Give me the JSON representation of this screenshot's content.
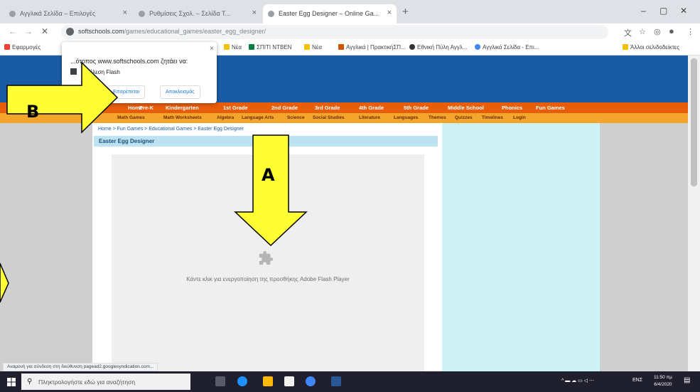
{
  "browser": {
    "tabs": [
      {
        "label": "Αγγλικά Σελίδα – Επιλογές"
      },
      {
        "label": "Ρυθμίσεις Σχολ. – Σελίδα Τ..."
      },
      {
        "label": "Easter Egg Designer – Online Ga..."
      }
    ],
    "newtab": "+",
    "win_controls": [
      "–",
      "▢",
      "✕"
    ],
    "url_host": "softschools.com",
    "url_path": "/games/educational_games/easter_egg_designer/",
    "bookmarks": [
      {
        "label": "Εφαρμογές"
      },
      {
        "label": "Νέα"
      },
      {
        "label": "ΣΠΙΤΙ ΝΤΒΕΝ"
      },
      {
        "label": "Νέα"
      },
      {
        "label": "Αγγλικά | ΠρακτικήΣΠ..."
      },
      {
        "label": "Εθνική Πύλη Αγγλ..."
      },
      {
        "label": "Αγγλικά Σελίδα - Επι..."
      },
      {
        "label": "Άλλοι σελιδοδείκτες"
      }
    ]
  },
  "popup": {
    "title": "...ότοπος www.softschools.com ζητάει να:",
    "row": "Εκτέλεση Flash",
    "allow": "Επιτρέπεται",
    "block": "Αποκλεισμός",
    "close": "×"
  },
  "site": {
    "nav1": [
      "Home",
      "Pre-K",
      "Kindergarten",
      "1st Grade",
      "2nd Grade",
      "3rd Grade",
      "4th Grade",
      "5th Grade",
      "Middle School",
      "Phonics",
      "Fun Games"
    ],
    "nav2": [
      "Math Games",
      "Math Worksheets",
      "Algebra",
      "Language Arts",
      "Science",
      "Social Studies",
      "Literature",
      "Languages",
      "Themes",
      "Quizzes",
      "Timelines",
      "Login"
    ],
    "breadcrumb": "Home > Fun Games > Educational Games > Easter Egg Designer",
    "page_title": "Easter Egg Designer",
    "plugin_message": "Κάντε κλικ για ενεργοποίηση της προσθήκης Adobe Flash Player"
  },
  "status_text": "Αναμονή για σύνδεση στη διεύθυνση pagead2.googlesyndication.com...",
  "taskbar": {
    "search_placeholder": "Πληκτρολογήστε εδώ για αναζήτηση",
    "tray_text": "ΕΝΣ",
    "clock_time": "11:50 πμ",
    "clock_date": "6/4/2020"
  },
  "annotations": {
    "a": "A",
    "b": "B"
  },
  "colors": {
    "arrow_fill": "#ffff33",
    "site_blue": "#1a5ba6",
    "nav_orange": "#e85d0a",
    "nav_yellow": "#f4a52c"
  },
  "icons": {
    "plugin": "puzzle-piece-icon",
    "lock": "lock-icon"
  }
}
